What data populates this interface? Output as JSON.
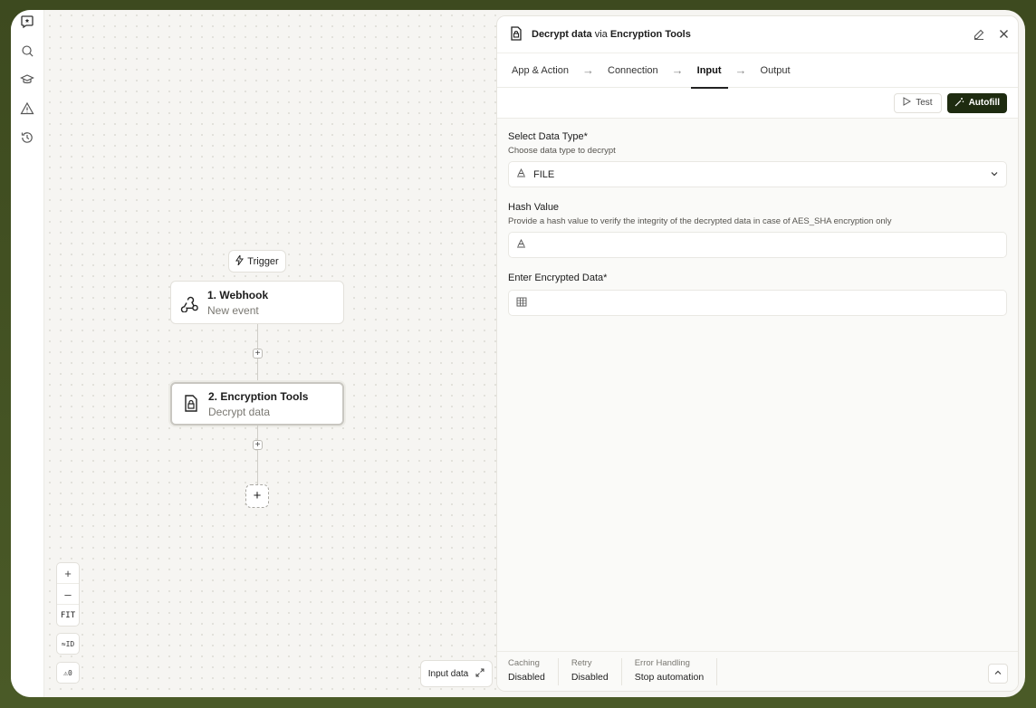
{
  "rail": {
    "icons": [
      "chat-icon",
      "search-icon",
      "graduation-cap-icon",
      "warning-icon",
      "history-icon"
    ]
  },
  "canvas": {
    "trigger_label": "Trigger",
    "nodes": [
      {
        "title": "1. Webhook",
        "subtitle": "New event",
        "icon": "webhook-icon"
      },
      {
        "title": "2. Encryption Tools",
        "subtitle": "Decrypt data",
        "icon": "document-lock-icon"
      }
    ],
    "zoom": {
      "plus": "+",
      "minus": "–",
      "fit": "FIT"
    },
    "id_toggle": "ID",
    "warnings_count": "0",
    "input_data_label": "Input data"
  },
  "panel": {
    "title_action": "Decrypt data",
    "title_via": "via",
    "title_app": "Encryption Tools",
    "steps": [
      "App & Action",
      "Connection",
      "Input",
      "Output"
    ],
    "active_step": "Input",
    "test_label": "Test",
    "autofill_label": "Autofill",
    "fields": {
      "data_type": {
        "label": "Select Data Type*",
        "help": "Choose data type to decrypt",
        "value": "FILE"
      },
      "hash": {
        "label": "Hash Value",
        "help": "Provide a hash value to verify the integrity of the decrypted data in case of AES_SHA encryption only",
        "value": ""
      },
      "encrypted": {
        "label": "Enter Encrypted Data*",
        "value": ""
      }
    },
    "footer": {
      "caching_label": "Caching",
      "caching_value": "Disabled",
      "retry_label": "Retry",
      "retry_value": "Disabled",
      "error_label": "Error Handling",
      "error_value": "Stop automation"
    }
  },
  "colors": {
    "accent": "#1e2b10",
    "frame_border": "#3d4a1f"
  }
}
